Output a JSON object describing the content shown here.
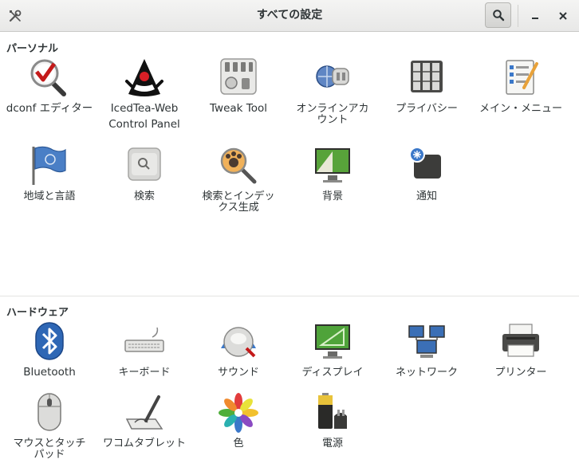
{
  "window": {
    "title": "すべての設定"
  },
  "sections": {
    "personal": {
      "title": "パーソナル"
    },
    "hardware": {
      "title": "ハードウェア"
    }
  },
  "personal_items": [
    {
      "label": "dconf エディター",
      "icon": "dconf-editor-icon"
    },
    {
      "label": "IcedTea-Web\nControl Panel",
      "icon": "java-duke-icon"
    },
    {
      "label": "Tweak Tool",
      "icon": "tweak-tool-icon"
    },
    {
      "label": "オンラインアカ\nウント",
      "icon": "online-accounts-icon"
    },
    {
      "label": "プライバシー",
      "icon": "privacy-icon"
    },
    {
      "label": "メイン・メニュー",
      "icon": "main-menu-icon"
    },
    {
      "label": "地域と言語",
      "icon": "region-flag-icon"
    },
    {
      "label": "検索",
      "icon": "search-settings-icon"
    },
    {
      "label": "検索とインデッ\nクス生成",
      "icon": "tracker-search-icon"
    },
    {
      "label": "背景",
      "icon": "background-icon"
    },
    {
      "label": "通知",
      "icon": "notifications-icon"
    }
  ],
  "hardware_items": [
    {
      "label": "Bluetooth",
      "icon": "bluetooth-icon"
    },
    {
      "label": "キーボード",
      "icon": "keyboard-icon"
    },
    {
      "label": "サウンド",
      "icon": "sound-icon"
    },
    {
      "label": "ディスプレイ",
      "icon": "display-icon"
    },
    {
      "label": "ネットワーク",
      "icon": "network-icon"
    },
    {
      "label": "プリンター",
      "icon": "printer-icon"
    },
    {
      "label": "マウスとタッチ\nパッド",
      "icon": "mouse-icon"
    },
    {
      "label": "ワコムタブレット",
      "icon": "wacom-tablet-icon"
    },
    {
      "label": "色",
      "icon": "color-icon"
    },
    {
      "label": "電源",
      "icon": "power-battery-icon"
    }
  ],
  "colors": {
    "accent": "#3b78c9",
    "text": "#2e3436"
  }
}
